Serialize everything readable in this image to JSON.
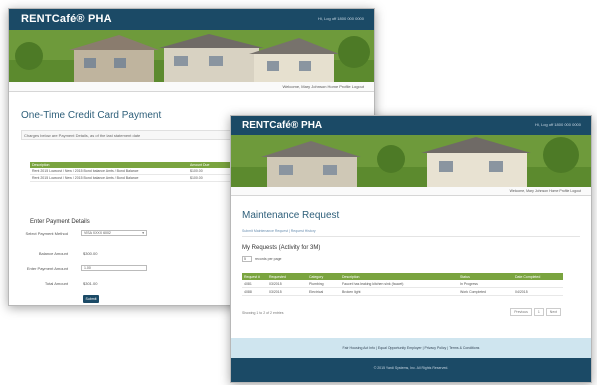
{
  "colors": {
    "header_navy": "#1b4a66",
    "grid_green": "#7aa43f",
    "title_blue": "#2e5f7a",
    "footer_lightblue": "#cfe5ef"
  },
  "window_a": {
    "logo": "RENTCafé® PHA",
    "top_links": "Hi, Log off   1800 000 0000",
    "nav_links": "Welcome, Mary Johnson    Home    Profile    Logout",
    "page_title": "One-Time Credit Card Payment",
    "breadcrumb": "Charges below are Payment Details, as of the last statement date",
    "grid_headers": [
      "Description",
      "Amount Due",
      ""
    ],
    "grid_rows": [
      {
        "desc": "Rent 2015 Lowcost / New / 2015 Bond balance Amts / Bond Balance",
        "amount": "$100.00"
      },
      {
        "desc": "Rent 2015 Lowcost / New / 2015 Bond balance Amts / Bond Balance",
        "amount": "$100.00"
      }
    ],
    "payment_section_title": "Enter Payment Details",
    "fields": {
      "select_payment_label": "Select Payment Method",
      "select_payment_value": "VISA XXXX 6002",
      "balance_label": "Balance Amount",
      "balance_value": "$300.00",
      "amount_label": "Enter Payment Amount",
      "amount_value": "1.00",
      "total_label": "Total Amount",
      "total_value": "$301.00"
    },
    "submit_label": "Submit"
  },
  "window_b": {
    "logo": "RENTCafé® PHA",
    "top_links": "Hi, Log off   1800 000 0000",
    "nav_links": "Welcome, Mary Johnson    Home    Profile    Logout",
    "page_title": "Maintenance Request",
    "breadcrumbs": "Submit Maintenance Request  |  Request History",
    "section_title": "My Requests (Activity for 3M)",
    "page_size": "5",
    "page_size_label": "records per page",
    "grid_headers": [
      "Request #",
      "Requested",
      "Category",
      "Description",
      "Status",
      "Date Completed"
    ],
    "grid_rows": [
      {
        "num": "4081",
        "date": "03/2015",
        "category": "Plumbing",
        "desc": "Faucet has leaking kitchen sink (faucet)",
        "status": "In Progress",
        "completed": ""
      },
      {
        "num": "4088",
        "date": "03/2015",
        "category": "Electrical",
        "desc": "Broken light",
        "status": "Work Completed",
        "completed": "04/2015"
      }
    ],
    "showing_text": "Showing 1 to 2 of 2 entries",
    "pager": [
      "Previous",
      "1",
      "Next"
    ],
    "footer_links": "Fair Housing Act Info   |   Equal Opportunity Employer   |   Privacy Policy   |   Terms & Conditions",
    "footer_copyright": "© 2015 Yardi Systems, Inc. All Rights Reserved."
  }
}
